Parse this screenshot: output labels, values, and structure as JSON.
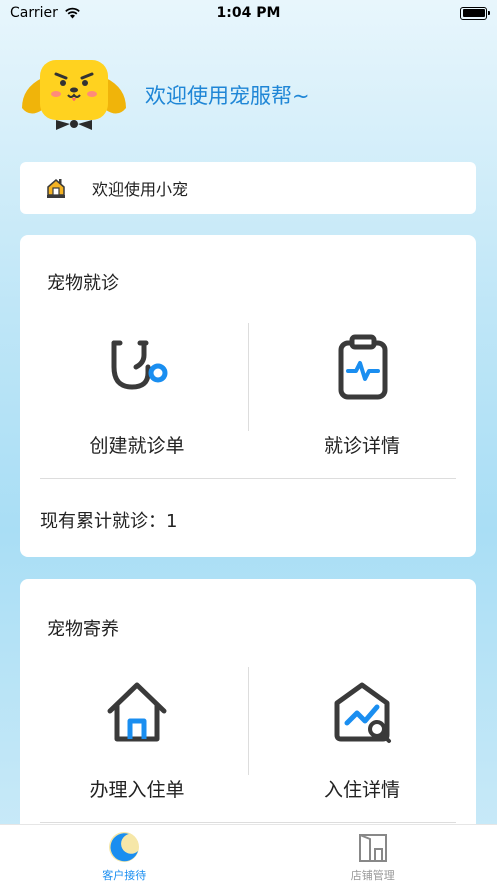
{
  "status_bar": {
    "carrier": "Carrier",
    "time": "1:04 PM"
  },
  "header": {
    "title": "欢迎使用宠服帮~"
  },
  "notice": {
    "text": "欢迎使用小宠",
    "icon": "house-icon"
  },
  "clinic_card": {
    "title": "宠物就诊",
    "actions": [
      {
        "label": "创建就诊单",
        "icon": "stethoscope-icon"
      },
      {
        "label": "就诊详情",
        "icon": "clipboard-heartbeat-icon"
      }
    ],
    "count_text": "现有累计就诊：1"
  },
  "boarding_card": {
    "title": "宠物寄养",
    "actions": [
      {
        "label": "办理入住单",
        "icon": "home-icon"
      },
      {
        "label": "入住详情",
        "icon": "home-chart-search-icon"
      }
    ]
  },
  "tabbar": {
    "tabs": [
      {
        "label": "客户接待",
        "active": true,
        "icon": "moon-icon"
      },
      {
        "label": "店铺管理",
        "active": false,
        "icon": "store-icon"
      }
    ]
  },
  "colors": {
    "accent": "#1f86d6",
    "icon_dark": "#3a3a3a",
    "icon_blue": "#1a8ef0",
    "inactive": "#999999"
  }
}
